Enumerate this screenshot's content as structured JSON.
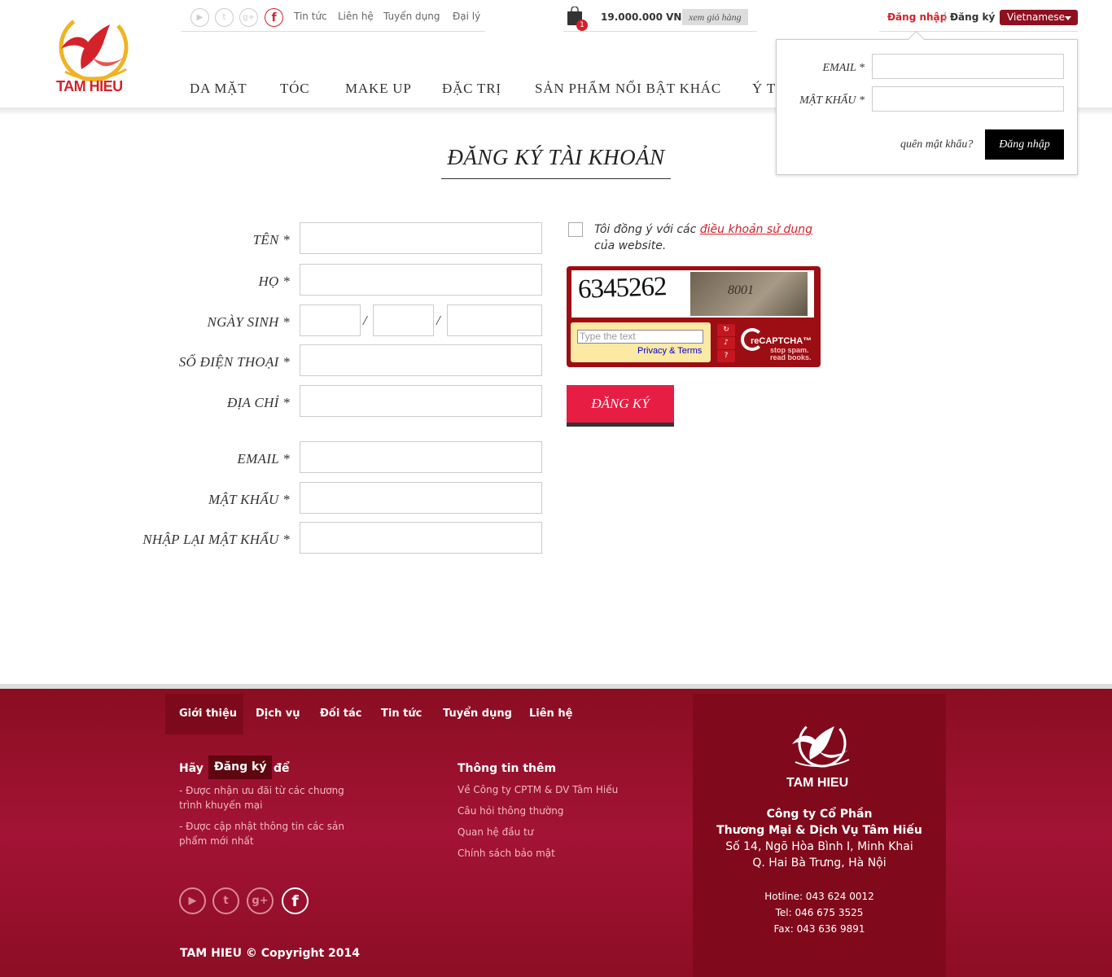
{
  "brand": {
    "name": "TAM HIEU",
    "color": "#d3222a"
  },
  "topbar": {
    "social": [
      {
        "icon": "youtube-icon",
        "glyph": "▶"
      },
      {
        "icon": "twitter-icon",
        "glyph": "t"
      },
      {
        "icon": "googleplus-icon",
        "glyph": "g+"
      },
      {
        "icon": "facebook-icon",
        "glyph": "f"
      }
    ],
    "links": [
      "Tin tức",
      "Liên hệ",
      "Tuyển dụng",
      "Đại lý"
    ],
    "cart": {
      "count": "1",
      "total": "19.000.000 VND",
      "view_label": "xem giỏ hàng"
    },
    "auth": {
      "login": "Đăng nhập",
      "separator": "|",
      "register": "Đăng ký"
    },
    "language": "Vietnamese"
  },
  "nav": [
    "DA MẶT",
    "TÓC",
    "MAKE UP",
    "ĐẶC TRỊ",
    "SẢN PHẨM NỔI BẬT KHÁC",
    "Ý T"
  ],
  "login_popup": {
    "email_label": "EMAIL *",
    "password_label": "MẬT KHẨU *",
    "forgot": "quên mật khẩu?",
    "submit": "Đăng nhập"
  },
  "form": {
    "title": "ĐĂNG KÝ TÀI KHOẢN",
    "labels": {
      "first_name": "TÊN *",
      "last_name": "HỌ *",
      "dob": "NGÀY SINH *",
      "phone": "SỐ ĐIỆN THOẠI *",
      "address": "ĐỊA CHỈ *",
      "email": "EMAIL *",
      "password": "MẬT KHẨU *",
      "confirm_password": "NHẬP LẠI MẬT KHẨU *"
    },
    "dob_separator": "/",
    "agree_prefix": "Tôi đồng ý với các ",
    "agree_link": "điều khoản sử dụng",
    "agree_suffix": " của website.",
    "captcha": {
      "word": "6345262",
      "photo_number": "8001",
      "placeholder": "Type the text",
      "privacy": "Privacy & Terms",
      "brand": "reCAPTCHA™",
      "tagline_1": "stop spam.",
      "tagline_2": "read books.",
      "buttons": [
        "↻",
        "♪",
        "?"
      ]
    },
    "submit": "ĐĂNG KÝ"
  },
  "footer": {
    "nav": [
      "Giới thiệu",
      "Dịch vụ",
      "Đối tác",
      "Tin tức",
      "Tuyển dụng",
      "Liên hệ"
    ],
    "signup": {
      "prefix": "Hãy",
      "button": "Đăng ký",
      "suffix": "để"
    },
    "benefits": [
      "- Được nhận ưu đãi từ các chương trình khuyến mại",
      "- Được cập nhật thông tin các sản phẩm mới nhất"
    ],
    "more_title": "Thông tin thêm",
    "more_links": [
      "Về Công ty CPTM & DV Tâm Hiếu",
      "Câu hỏi thông thường",
      "Quan hệ đầu tư",
      "Chính sách bảo mật"
    ],
    "social": [
      {
        "icon": "youtube-icon",
        "glyph": "▶"
      },
      {
        "icon": "twitter-icon",
        "glyph": "t"
      },
      {
        "icon": "googleplus-icon",
        "glyph": "g+"
      },
      {
        "icon": "facebook-icon",
        "glyph": "f"
      }
    ],
    "copyright": "TAM HIEU © Copyright 2014",
    "logo_text": "TAM HIEU",
    "company": [
      "Công ty Cổ Phần",
      "Thương Mại & Dịch Vụ Tâm Hiếu",
      "Số 14, Ngõ Hòa Bình I, Minh Khai",
      "Q. Hai Bà Trưng, Hà Nội"
    ],
    "contacts": [
      "Hotline: 043 624 0012",
      "Tel: 046 675 3525",
      "Fax: 043 636 9891"
    ]
  }
}
